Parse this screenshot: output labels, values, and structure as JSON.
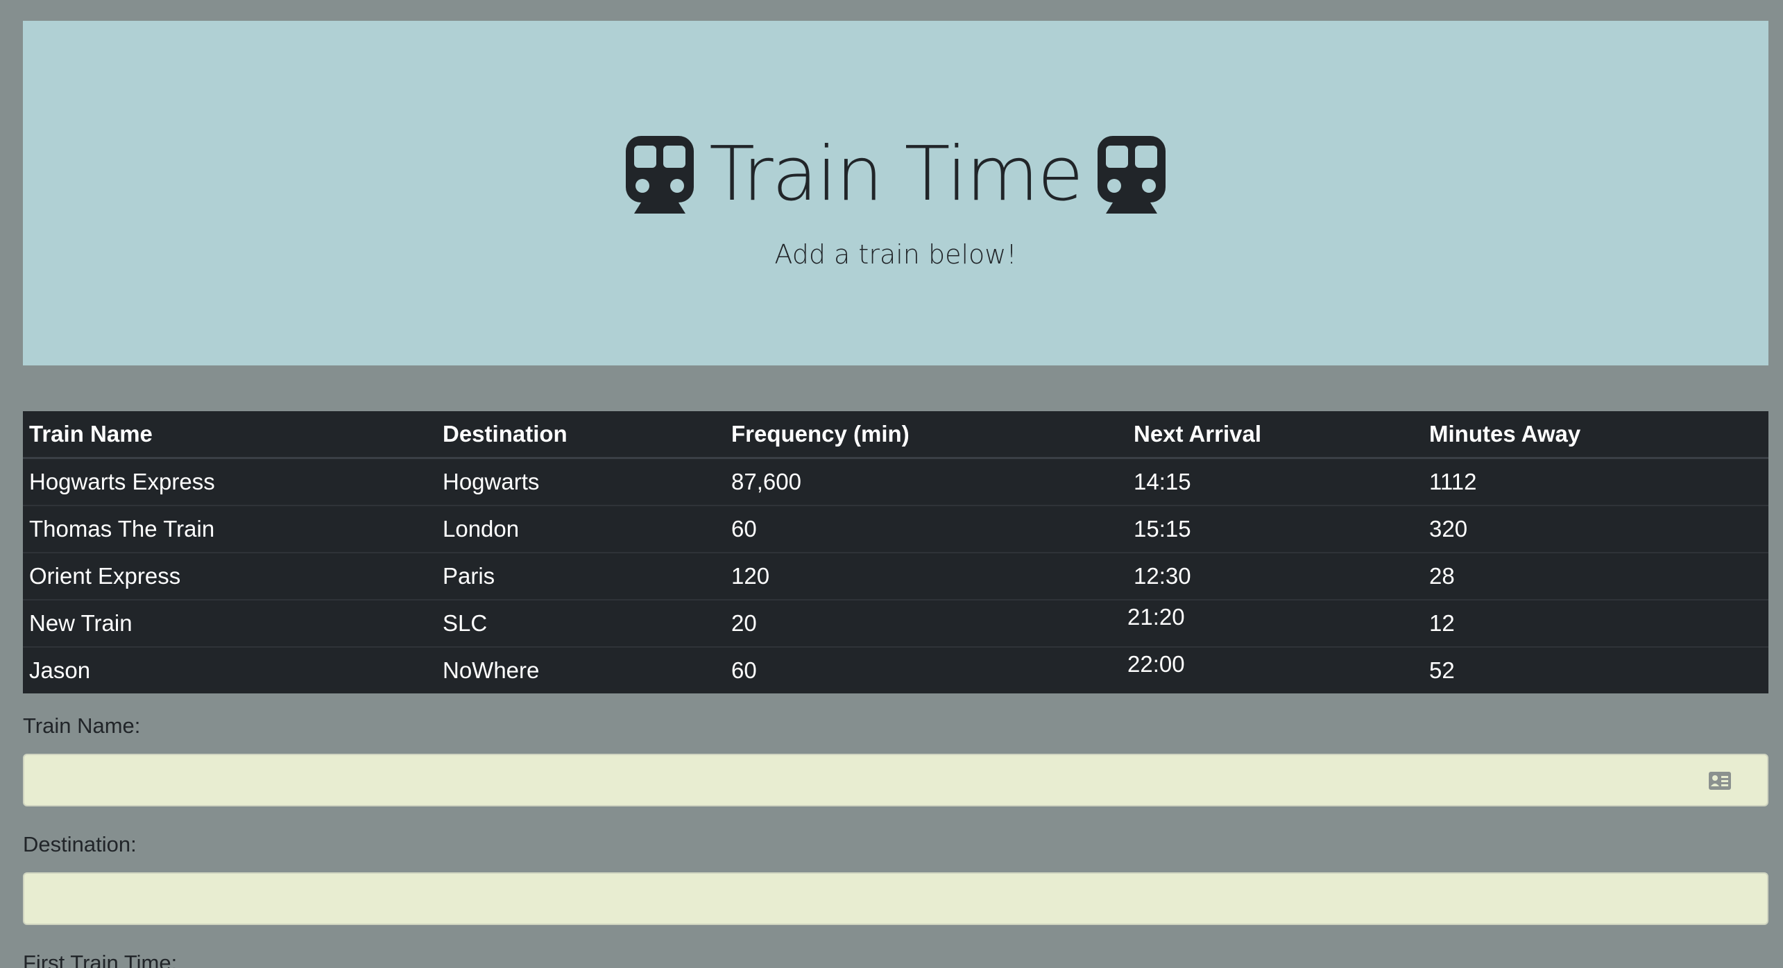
{
  "header": {
    "title": "Train Time",
    "subtitle": "Add a train below!",
    "icon_left": "train-icon",
    "icon_right": "train-icon"
  },
  "table": {
    "columns": [
      "Train Name",
      "Destination",
      "Frequency (min)",
      "Next Arrival",
      "Minutes Away"
    ],
    "rows": [
      {
        "name": "Hogwarts Express",
        "destination": "Hogwarts",
        "frequency": "87,600",
        "next_arrival": "14:15",
        "minutes_away": "1112"
      },
      {
        "name": "Thomas The Train",
        "destination": "London",
        "frequency": "60",
        "next_arrival": "15:15",
        "minutes_away": "320"
      },
      {
        "name": "Orient Express",
        "destination": "Paris",
        "frequency": "120",
        "next_arrival": "12:30",
        "minutes_away": "28"
      },
      {
        "name": "New Train",
        "destination": "SLC",
        "frequency": "20",
        "next_arrival": "21:20",
        "minutes_away": "12"
      },
      {
        "name": "Jason",
        "destination": "NoWhere",
        "frequency": "60",
        "next_arrival": "22:00",
        "minutes_away": "52"
      }
    ]
  },
  "form": {
    "train_name_label": "Train Name:",
    "train_name_value": "",
    "destination_label": "Destination:",
    "destination_value": "",
    "first_train_label": "First Train Time:"
  },
  "colors": {
    "background": "#858f8f",
    "jumbotron": "#b0d0d4",
    "table": "#212529",
    "input": "#e8edd1"
  }
}
